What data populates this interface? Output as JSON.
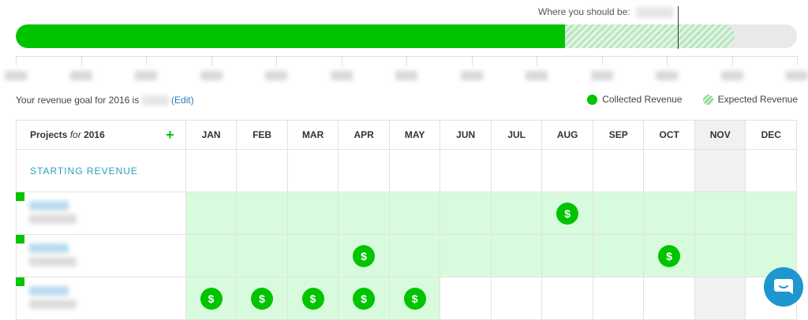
{
  "progress": {
    "where_label": "Where you should be:",
    "collected_fraction": 0.703,
    "expected_fraction": 0.92,
    "marker_fraction": 0.847
  },
  "goal": {
    "prefix": "Your revenue goal for 2016 is",
    "edit_label": "(Edit)"
  },
  "legend": {
    "collected": "Collected Revenue",
    "expected": "Expected Revenue"
  },
  "table": {
    "projects_label": "Projects",
    "for_label": "for",
    "year": "2016",
    "add_label": "+",
    "months": [
      "JAN",
      "FEB",
      "MAR",
      "APR",
      "MAY",
      "JUN",
      "JUL",
      "AUG",
      "SEP",
      "OCT",
      "NOV",
      "DEC"
    ],
    "current_month_index": 10,
    "starting_revenue_label": "STARTING REVENUE",
    "coin_symbol": "$",
    "projects": [
      {
        "green_from": 0,
        "green_to": 11,
        "payments": [
          7
        ]
      },
      {
        "green_from": 0,
        "green_to": 11,
        "payments": [
          3,
          9
        ]
      },
      {
        "green_from": 0,
        "green_to": 4,
        "payments": [
          0,
          1,
          2,
          3,
          4
        ]
      }
    ]
  },
  "colors": {
    "accent_green": "#00c400",
    "row_green": "#d9fbdd",
    "link_blue": "#2a7fbf",
    "chat_blue": "#1e97cf"
  },
  "icons": {
    "chat": "chat-icon",
    "add": "plus-icon",
    "payment": "dollar-icon"
  }
}
